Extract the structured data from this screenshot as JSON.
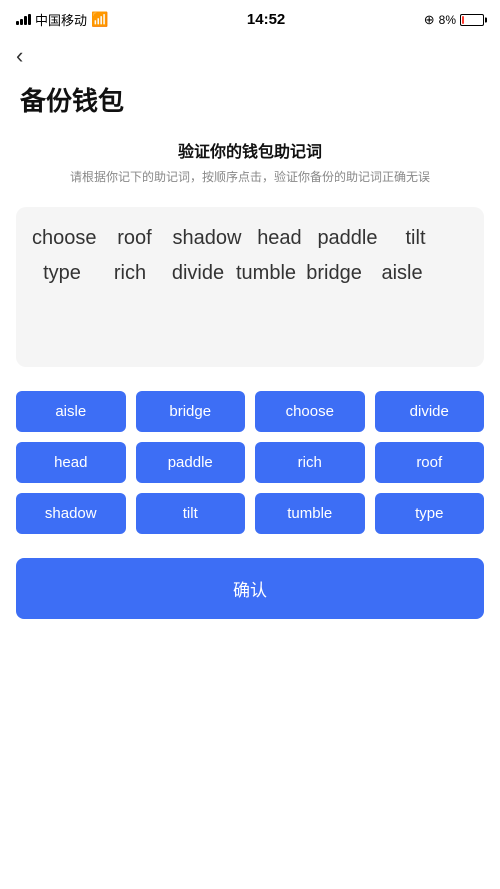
{
  "statusBar": {
    "carrier": "中国移动",
    "time": "14:52",
    "battery": "8%"
  },
  "backBtn": "‹",
  "pageTitle": "备份钱包",
  "sectionTitle": "验证你的钱包助记词",
  "sectionDesc": "请根据你记下的助记词，按顺序点击，验证你备份的助记词正确无误",
  "displayedWords": [
    {
      "id": 0,
      "text": "choose"
    },
    {
      "id": 1,
      "text": "roof"
    },
    {
      "id": 2,
      "text": "shadow"
    },
    {
      "id": 3,
      "text": "head"
    },
    {
      "id": 4,
      "text": "paddle"
    },
    {
      "id": 5,
      "text": "tilt"
    },
    {
      "id": 6,
      "text": "type"
    },
    {
      "id": 7,
      "text": "rich"
    },
    {
      "id": 8,
      "text": "divide"
    },
    {
      "id": 9,
      "text": "tumble"
    },
    {
      "id": 10,
      "text": "bridge"
    },
    {
      "id": 11,
      "text": "aisle"
    }
  ],
  "wordButtons": [
    "aisle",
    "bridge",
    "choose",
    "divide",
    "head",
    "paddle",
    "rich",
    "roof",
    "shadow",
    "tilt",
    "tumble",
    "type"
  ],
  "confirmLabel": "确认"
}
